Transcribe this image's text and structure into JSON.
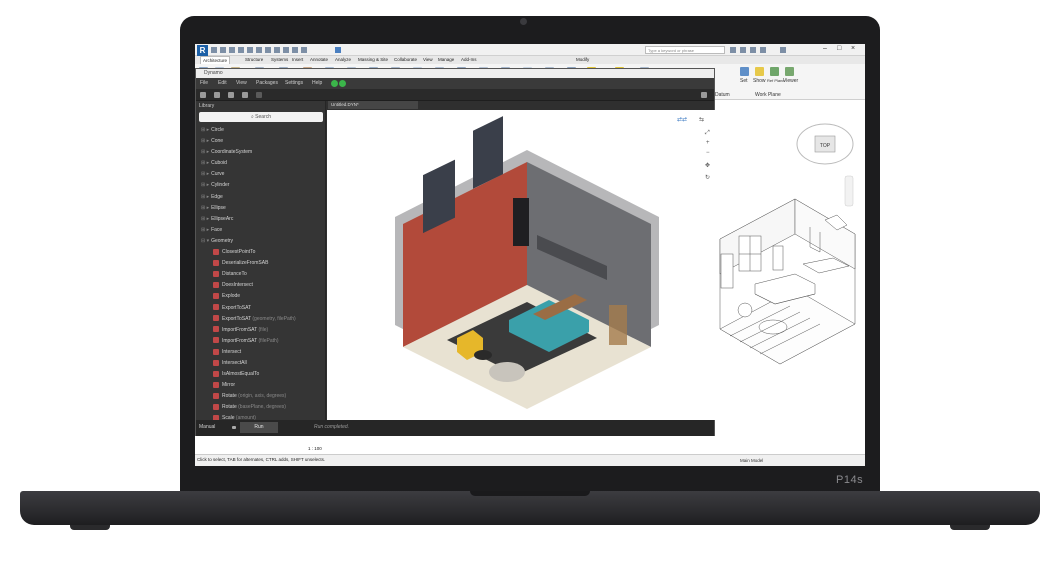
{
  "device": {
    "brand": "P14s"
  },
  "revit": {
    "logo": "R",
    "search_placeholder": "Type a keyword or phrase",
    "window_controls": {
      "minimize": "–",
      "maximize": "□",
      "close": "×"
    },
    "tabs": [
      "Architecture",
      "Structure",
      "Systems",
      "Insert",
      "Annotate",
      "Analyze",
      "Massing & Site",
      "Collaborate",
      "View",
      "Manage",
      "Add-Ins",
      "Modify"
    ],
    "ribbon": {
      "work_plane_label": "Work Plane",
      "datum_label": "Datum",
      "set_label": "Set",
      "show_label": "Show",
      "viewer_label": "Viewer",
      "ref_label": "Ref Plane"
    },
    "viewcube_label": "TOP",
    "scale": "1 : 100",
    "status": "Click to select, TAB for alternates, CTRL adds, SHIFT unselects.",
    "model_label": "Main Model"
  },
  "dynamo": {
    "title": "Dynamo",
    "menu": [
      "File",
      "Edit",
      "View",
      "Packages",
      "Settings",
      "Help"
    ],
    "library_header": "Library",
    "search_label": "Search",
    "workspace_tab": "Untitled.DYN*",
    "library_items": [
      {
        "label": "Circle",
        "type": "cat"
      },
      {
        "label": "Cone",
        "type": "cat"
      },
      {
        "label": "CoordinateSystem",
        "type": "cat"
      },
      {
        "label": "Cuboid",
        "type": "cat"
      },
      {
        "label": "Curve",
        "type": "cat"
      },
      {
        "label": "Cylinder",
        "type": "cat"
      },
      {
        "label": "Edge",
        "type": "cat"
      },
      {
        "label": "Ellipse",
        "type": "cat"
      },
      {
        "label": "EllipseArc",
        "type": "cat"
      },
      {
        "label": "Face",
        "type": "cat"
      },
      {
        "label": "Geometry",
        "type": "cat-open"
      },
      {
        "label": "ClosestPointTo",
        "type": "child",
        "param": ""
      },
      {
        "label": "DeserializeFromSAB",
        "type": "child",
        "param": ""
      },
      {
        "label": "DistanceTo",
        "type": "child",
        "param": ""
      },
      {
        "label": "DoesIntersect",
        "type": "child",
        "param": ""
      },
      {
        "label": "Explode",
        "type": "child",
        "param": ""
      },
      {
        "label": "ExportToSAT",
        "type": "child",
        "param": ""
      },
      {
        "label": "ExportToSAT",
        "type": "child",
        "param": "(geometry, filePath)"
      },
      {
        "label": "ImportFromSAT",
        "type": "child",
        "param": "(file)"
      },
      {
        "label": "ImportFromSAT",
        "type": "child",
        "param": "(filePath)"
      },
      {
        "label": "Intersect",
        "type": "child",
        "param": ""
      },
      {
        "label": "IntersectAll",
        "type": "child",
        "param": ""
      },
      {
        "label": "IsAlmostEqualTo",
        "type": "child",
        "param": ""
      },
      {
        "label": "Mirror",
        "type": "child",
        "param": ""
      },
      {
        "label": "Rotate",
        "type": "child",
        "param": "(origin, axis, degrees)"
      },
      {
        "label": "Rotate",
        "type": "child",
        "param": "(basePlane, degrees)"
      },
      {
        "label": "Scale",
        "type": "child",
        "param": "(amount)"
      }
    ],
    "run_mode": "Manual",
    "run_button": "Run",
    "run_status": "Run completed."
  }
}
